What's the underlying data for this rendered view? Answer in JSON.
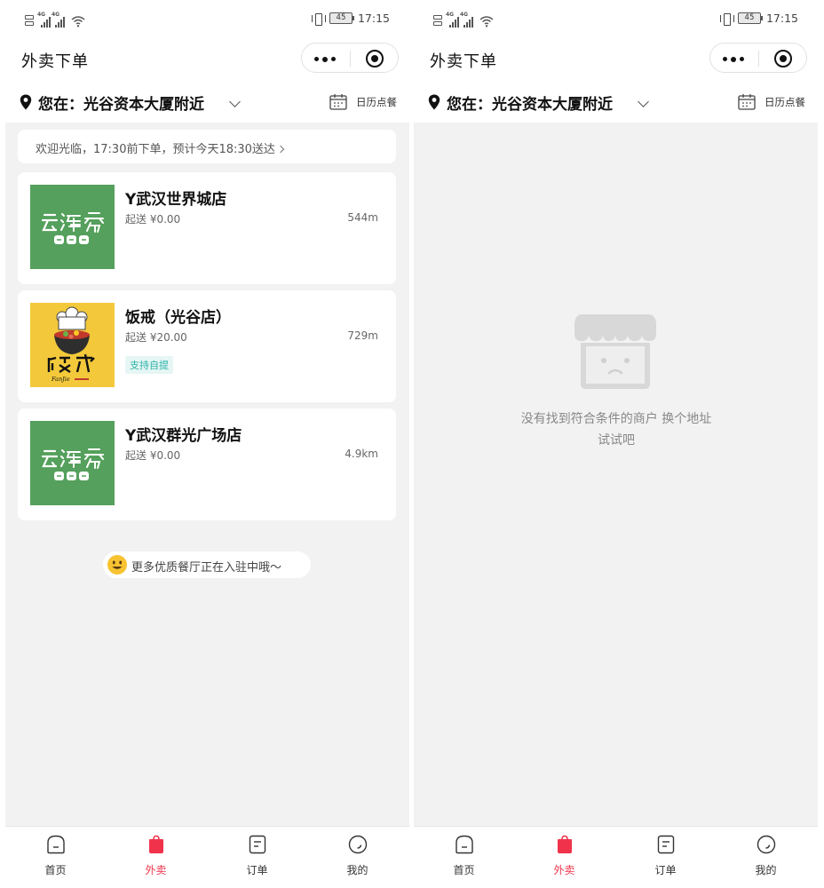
{
  "screens": [
    {
      "status": {
        "battery": "45",
        "time": "17:15"
      },
      "nav": {
        "title": "外卖下单"
      },
      "location": {
        "prefix": "您在：",
        "place": "光谷资本大厦附近",
        "calendar_label": "日历点餐"
      },
      "notice": "欢迎光临，17:30前下单，预计今天18:30送达",
      "shops": [
        {
          "name": "Y武汉世界城店",
          "min_order": "起送 ¥0.00",
          "distance": "544m",
          "logo": "yunhaiyao-logo"
        },
        {
          "name": "饭戒（光谷店）",
          "min_order": "起送 ¥20.00",
          "distance": "729m",
          "tag": "支持自提",
          "logo": "fanjie-logo"
        },
        {
          "name": "Y武汉群光广场店",
          "min_order": "起送 ¥0.00",
          "distance": "4.9km",
          "logo": "yunhaiyao-logo"
        }
      ],
      "more_note": "更多优质餐厅正在入驻中哦～",
      "tabs": [
        {
          "label": "首页",
          "icon": "home-icon"
        },
        {
          "label": "外卖",
          "icon": "takeout-bag-icon",
          "active": true
        },
        {
          "label": "订单",
          "icon": "order-icon"
        },
        {
          "label": "我的",
          "icon": "profile-icon"
        }
      ]
    },
    {
      "status": {
        "battery": "45",
        "time": "17:15"
      },
      "nav": {
        "title": "外卖下单"
      },
      "location": {
        "prefix": "您在：",
        "place": "光谷资本大厦附近",
        "calendar_label": "日历点餐"
      },
      "empty": {
        "line1": "没有找到符合条件的商户 换个地址",
        "line2": "试试吧"
      },
      "tabs": [
        {
          "label": "首页",
          "icon": "home-icon"
        },
        {
          "label": "外卖",
          "icon": "takeout-bag-icon",
          "active": true
        },
        {
          "label": "订单",
          "icon": "order-icon"
        },
        {
          "label": "我的",
          "icon": "profile-icon"
        }
      ]
    }
  ],
  "colors": {
    "accent": "#f0334b",
    "tag": "#2bb3a8",
    "logo_green": "#54a05c",
    "logo_yellow": "#f3c93b",
    "page_bg": "#f2f2f2"
  }
}
